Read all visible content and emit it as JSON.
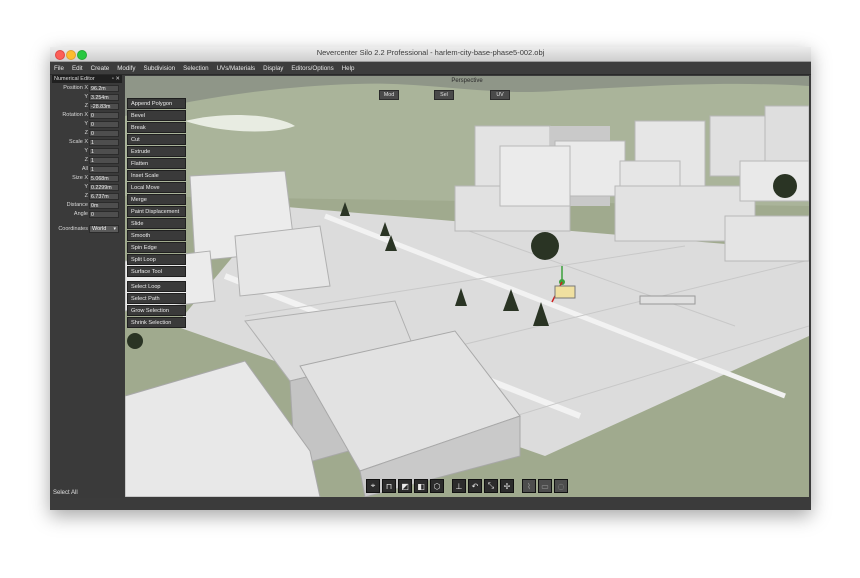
{
  "window": {
    "title": "Nevercenter Silo 2.2 Professional - harlem-city-base-phase5-002.obj"
  },
  "menubar": [
    "File",
    "Edit",
    "Create",
    "Modify",
    "Subdivision",
    "Selection",
    "UVs/Materials",
    "Display",
    "Editors/Options",
    "Help"
  ],
  "numerical_editor": {
    "title": "Numerical Editor",
    "rows": [
      {
        "label": "Position X",
        "value": "96.2m"
      },
      {
        "label": "Y",
        "value": "3.254m"
      },
      {
        "label": "Z",
        "value": "-28.83m"
      },
      {
        "label": "Rotation X",
        "value": "0"
      },
      {
        "label": "Y",
        "value": "0"
      },
      {
        "label": "Z",
        "value": "0"
      },
      {
        "label": "Scale X",
        "value": "1"
      },
      {
        "label": "Y",
        "value": "1"
      },
      {
        "label": "Z",
        "value": "1"
      },
      {
        "label": "All",
        "value": "1"
      },
      {
        "label": "Size X",
        "value": "5.068m"
      },
      {
        "label": "Y",
        "value": "0.2299m"
      },
      {
        "label": "Z",
        "value": "6.737m"
      },
      {
        "label": "Distance",
        "value": "0m"
      },
      {
        "label": "Angle",
        "value": "0"
      }
    ],
    "coordinates_label": "Coordinates",
    "coordinates_value": "World"
  },
  "viewport": {
    "view_name": "Perspective",
    "buttons": [
      "Mod",
      "Sel",
      "UV"
    ]
  },
  "tool_menu": {
    "group1": [
      "Append Polygon",
      "Bevel",
      "Break",
      "Cut",
      "Extrude",
      "Flatten",
      "Inset Scale",
      "Local Move",
      "Merge",
      "Paint Displacement",
      "Slide",
      "Smooth",
      "Spin Edge",
      "Split Loop",
      "Surface Tool"
    ],
    "group2": [
      "Select Loop",
      "Select Path",
      "Grow Selection",
      "Shrink Selection"
    ]
  },
  "status_bar": {
    "text": "Select All"
  },
  "bottom_toolbar": {
    "icons": [
      "vertex-mode-icon",
      "edge-mode-icon",
      "face-mode-icon",
      "object-mode-icon",
      "multi-mode-icon",
      "move-tool-icon",
      "rotate-tool-icon",
      "scale-tool-icon",
      "universal-tool-icon",
      "tweak-icon",
      "select-rect-icon",
      "select-lasso-icon"
    ]
  },
  "colors": {
    "ground": "#9ca68c",
    "hill": "#b7c0a2",
    "building": "#e6e6e6",
    "panel": "#3a3a3a"
  }
}
